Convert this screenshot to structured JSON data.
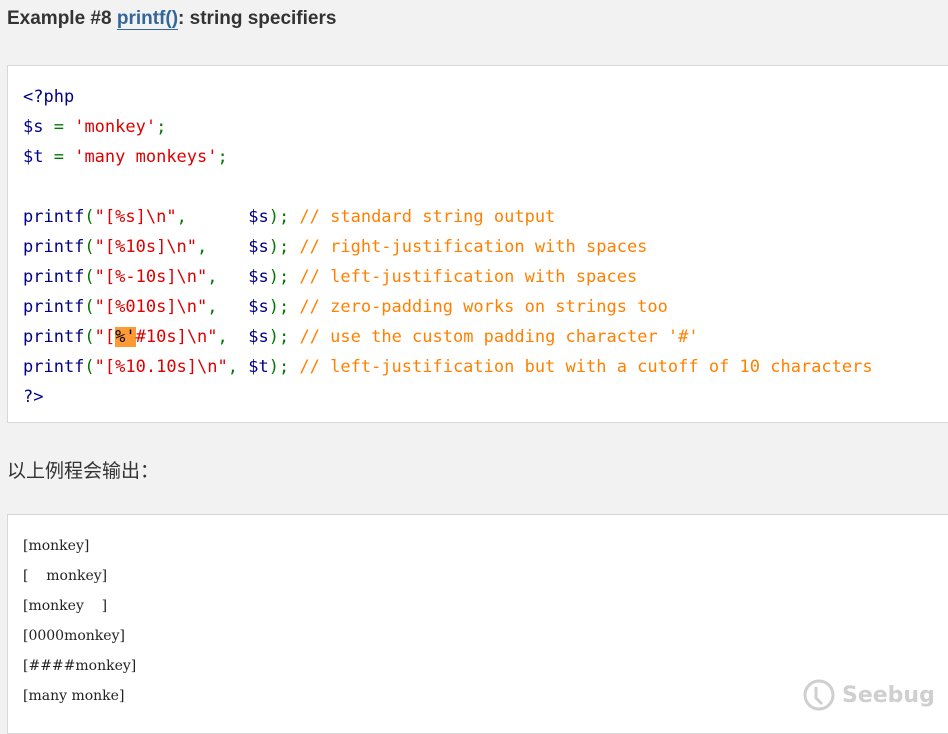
{
  "example": {
    "prefix": "Example #8 ",
    "link_text": "printf()",
    "suffix": ": string specifiers"
  },
  "code_lines": [
    [
      {
        "t": "<?php",
        "c": "kw"
      }
    ],
    [
      {
        "t": "$s",
        "c": "var"
      },
      {
        "t": " = ",
        "c": "op"
      },
      {
        "t": "'monkey'",
        "c": "str"
      },
      {
        "t": ";",
        "c": "op"
      }
    ],
    [
      {
        "t": "$t",
        "c": "var"
      },
      {
        "t": " = ",
        "c": "op"
      },
      {
        "t": "'many monkeys'",
        "c": "str"
      },
      {
        "t": ";",
        "c": "op"
      }
    ],
    [],
    [
      {
        "t": "printf",
        "c": "kw"
      },
      {
        "t": "(",
        "c": "op"
      },
      {
        "t": "\"[%s]\\n\"",
        "c": "str"
      },
      {
        "t": ",      ",
        "c": "op"
      },
      {
        "t": "$s",
        "c": "var"
      },
      {
        "t": "); ",
        "c": "op"
      },
      {
        "t": "// standard string output",
        "c": "cmt"
      }
    ],
    [
      {
        "t": "printf",
        "c": "kw"
      },
      {
        "t": "(",
        "c": "op"
      },
      {
        "t": "\"[%10s]\\n\"",
        "c": "str"
      },
      {
        "t": ",    ",
        "c": "op"
      },
      {
        "t": "$s",
        "c": "var"
      },
      {
        "t": "); ",
        "c": "op"
      },
      {
        "t": "// right-justification with spaces",
        "c": "cmt"
      }
    ],
    [
      {
        "t": "printf",
        "c": "kw"
      },
      {
        "t": "(",
        "c": "op"
      },
      {
        "t": "\"[%-10s]\\n\"",
        "c": "str"
      },
      {
        "t": ",   ",
        "c": "op"
      },
      {
        "t": "$s",
        "c": "var"
      },
      {
        "t": "); ",
        "c": "op"
      },
      {
        "t": "// left-justification with spaces",
        "c": "cmt"
      }
    ],
    [
      {
        "t": "printf",
        "c": "kw"
      },
      {
        "t": "(",
        "c": "op"
      },
      {
        "t": "\"[%010s]\\n\"",
        "c": "str"
      },
      {
        "t": ",   ",
        "c": "op"
      },
      {
        "t": "$s",
        "c": "var"
      },
      {
        "t": "); ",
        "c": "op"
      },
      {
        "t": "// zero-padding works on strings too",
        "c": "cmt"
      }
    ],
    [
      {
        "t": "printf",
        "c": "kw"
      },
      {
        "t": "(",
        "c": "op"
      },
      {
        "t": "\"[",
        "c": "str"
      },
      {
        "t": "%'",
        "c": "hl"
      },
      {
        "t": "#10s]\\n\"",
        "c": "str"
      },
      {
        "t": ",  ",
        "c": "op"
      },
      {
        "t": "$s",
        "c": "var"
      },
      {
        "t": "); ",
        "c": "op"
      },
      {
        "t": "// use the custom padding character '#'",
        "c": "cmt"
      }
    ],
    [
      {
        "t": "printf",
        "c": "kw"
      },
      {
        "t": "(",
        "c": "op"
      },
      {
        "t": "\"[%10.10s]\\n\"",
        "c": "str"
      },
      {
        "t": ", ",
        "c": "op"
      },
      {
        "t": "$t",
        "c": "var"
      },
      {
        "t": "); ",
        "c": "op"
      },
      {
        "t": "// left-justification but with a cutoff of 10 characters",
        "c": "cmt"
      }
    ],
    [
      {
        "t": "?>",
        "c": "kw"
      }
    ]
  ],
  "output_label": "以上例程会输出：",
  "output_lines": [
    "[monkey]",
    "[    monkey]",
    "[monkey    ]",
    "[0000monkey]",
    "[####monkey]",
    "[many monke]"
  ],
  "watermark": "Seebug"
}
